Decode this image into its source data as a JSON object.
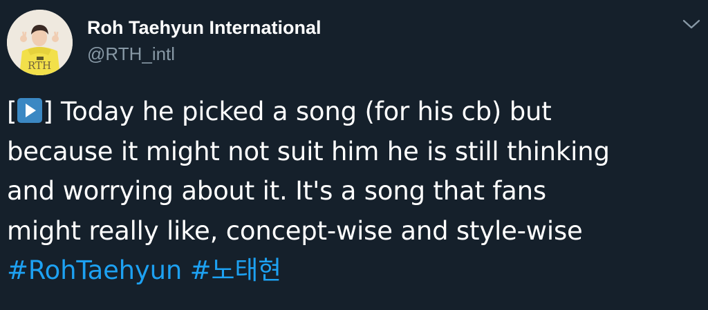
{
  "author": {
    "display_name": "Roh Taehyun International",
    "handle": "@RTH_intl",
    "avatar_text": "RTH"
  },
  "tweet": {
    "line1_before_emoji": "[",
    "play_emoji": "play-button-icon",
    "line1_after_emoji": "] Today he picked a song (for his cb) but",
    "line2": "because it might not suit him he is still thinking",
    "line3": "and worrying about it. It's a song that fans",
    "line4": "might really like, concept-wise and style-wise",
    "hashtags": [
      "#RohTaehyun",
      "#노태현"
    ]
  },
  "colors": {
    "background": "#15202b",
    "text": "#ffffff",
    "secondary": "#8899a6",
    "link": "#1da1f2",
    "emoji_bg": "#3b88c3"
  },
  "icons": {
    "menu": "chevron-down-icon"
  }
}
